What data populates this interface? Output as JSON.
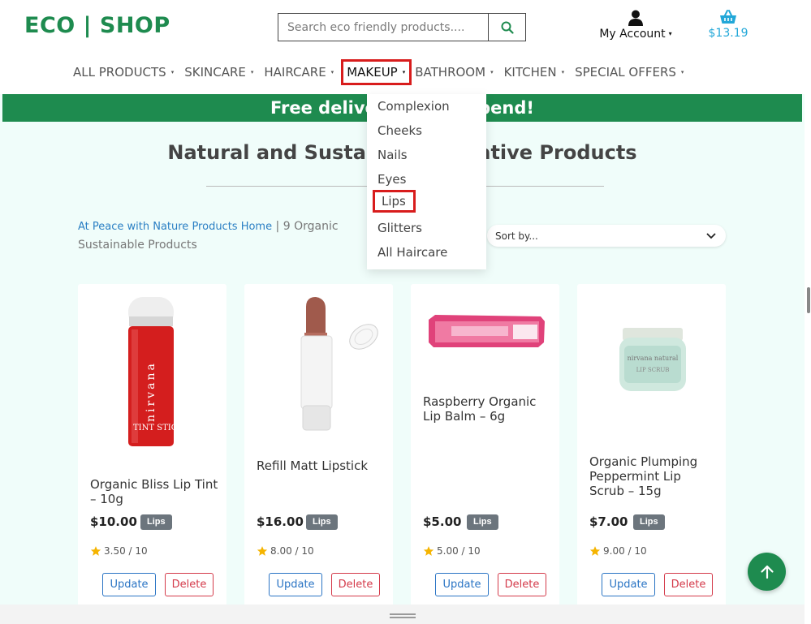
{
  "header": {
    "logo": "ECO | SHOP",
    "search_placeholder": "Search eco friendly products....",
    "account_label": "My Account",
    "account_caret": "▾",
    "cart_total": "$13.19"
  },
  "nav": {
    "items": [
      {
        "label": "ALL PRODUCTS"
      },
      {
        "label": "SKINCARE"
      },
      {
        "label": "HAIRCARE"
      },
      {
        "label": "MAKEUP"
      },
      {
        "label": "BATHROOM"
      },
      {
        "label": "KITCHEN"
      },
      {
        "label": "SPECIAL OFFERS"
      }
    ],
    "caret": "▾",
    "active_item": "MAKEUP"
  },
  "banner": {
    "text": "Free delivery over a spend!"
  },
  "main": {
    "title": "Natural and Sustainable Creative Products",
    "breadcrumb_link": "At Peace with Nature Products Home",
    "breadcrumb_sep": " | ",
    "breadcrumb_count": "9 Organic Sustainable Products",
    "sort_label": "Sort by..."
  },
  "dropdown": {
    "items": [
      "Complexion",
      "Cheeks",
      "Nails",
      "Eyes",
      "Lips",
      "Glitters",
      "All Haircare"
    ],
    "active_item": "Lips"
  },
  "products": [
    {
      "name": "Organic Bliss Lip Tint – 10g",
      "price": "$10.00",
      "badge": "Lips",
      "rating": "3.50 / 10",
      "update": "Update",
      "delete": "Delete"
    },
    {
      "name": "Refill Matt Lipstick",
      "price": "$16.00",
      "badge": "Lips",
      "rating": "8.00 / 10",
      "update": "Update",
      "delete": "Delete"
    },
    {
      "name": "Raspberry Organic Lip Balm – 6g",
      "price": "$5.00",
      "badge": "Lips",
      "rating": "5.00 / 10",
      "update": "Update",
      "delete": "Delete"
    },
    {
      "name": "Organic Plumping Peppermint Lip Scrub – 15g",
      "price": "$7.00",
      "badge": "Lips",
      "rating": "9.00 / 10",
      "update": "Update",
      "delete": "Delete"
    }
  ],
  "colors": {
    "brand_green": "#1e8b4f",
    "background": "#f0fdfa",
    "cart_blue": "#21a7d8",
    "highlight_red": "#d81c1c",
    "badge_gray": "#6c757d",
    "star": "#f5b400"
  },
  "icons": {
    "search": "search-icon",
    "user": "user-icon",
    "cart": "basket-icon",
    "sort": "chevron-down-icon",
    "star": "star-icon",
    "scroll_top": "arrow-up-icon"
  }
}
